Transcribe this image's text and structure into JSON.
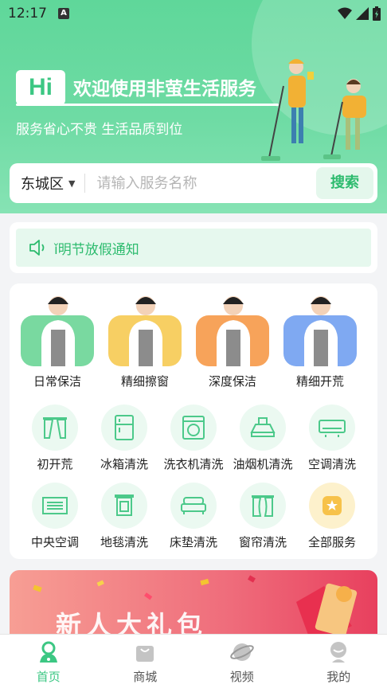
{
  "status_bar": {
    "time": "12:17",
    "notification_letter": "A"
  },
  "header": {
    "hi_badge": "Hi",
    "welcome": "欢迎使用非萤生活服务",
    "slogan": "服务省心不贵 生活品质到位"
  },
  "search": {
    "city": "东城区",
    "placeholder": "请输入服务名称",
    "button_label": "搜索"
  },
  "notice": {
    "text": "ǐ明节放假通知"
  },
  "featured_services": [
    {
      "label": "日常保洁",
      "color": "#79d9a0"
    },
    {
      "label": "精细擦窗",
      "color": "#f7cf63"
    },
    {
      "label": "深度保洁",
      "color": "#f7a35a"
    },
    {
      "label": "精细开荒",
      "color": "#7fa9f2"
    }
  ],
  "services": [
    {
      "label": "初开荒",
      "icon": "curtain-open-icon"
    },
    {
      "label": "冰箱清洗",
      "icon": "fridge-icon"
    },
    {
      "label": "洗衣机清洗",
      "icon": "washing-machine-icon"
    },
    {
      "label": "油烟机清洗",
      "icon": "range-hood-icon"
    },
    {
      "label": "空调清洗",
      "icon": "air-conditioner-icon"
    },
    {
      "label": "中央空调",
      "icon": "central-ac-icon"
    },
    {
      "label": "地毯清洗",
      "icon": "carpet-icon"
    },
    {
      "label": "床垫清洗",
      "icon": "mattress-icon"
    },
    {
      "label": "窗帘清洗",
      "icon": "curtain-icon"
    },
    {
      "label": "全部服务",
      "icon": "star-icon"
    }
  ],
  "banner": {
    "text": "新人大礼包"
  },
  "tabbar": [
    {
      "label": "首页",
      "icon": "home-icon",
      "active": true
    },
    {
      "label": "商城",
      "icon": "shop-bag-icon",
      "active": false
    },
    {
      "label": "视频",
      "icon": "planet-icon",
      "active": false
    },
    {
      "label": "我的",
      "icon": "profile-icon",
      "active": false
    }
  ],
  "colors": {
    "brand_green": "#3cc783",
    "header_green": "#5fd79a",
    "banner_red": "#e8405e"
  }
}
